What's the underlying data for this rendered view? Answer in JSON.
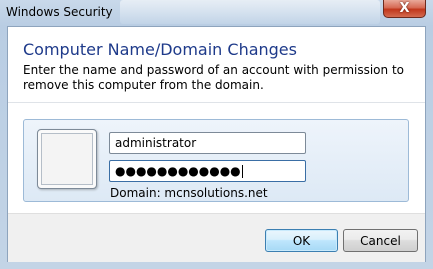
{
  "window": {
    "title": "Windows Security",
    "close_glyph": "X"
  },
  "dialog": {
    "heading": "Computer Name/Domain Changes",
    "instructions": "Enter the name and password of an account with permission to remove this computer from the domain."
  },
  "credentials": {
    "username_value": "administrator",
    "password_mask": "●●●●●●●●●●●●",
    "domain_text": "Domain: mcnsolutions.net"
  },
  "buttons": {
    "ok_label": "OK",
    "cancel_label": "Cancel"
  },
  "colors": {
    "heading": "#1e3a8a",
    "close_button": "#c1371c",
    "panel_border": "#9dbad7"
  }
}
